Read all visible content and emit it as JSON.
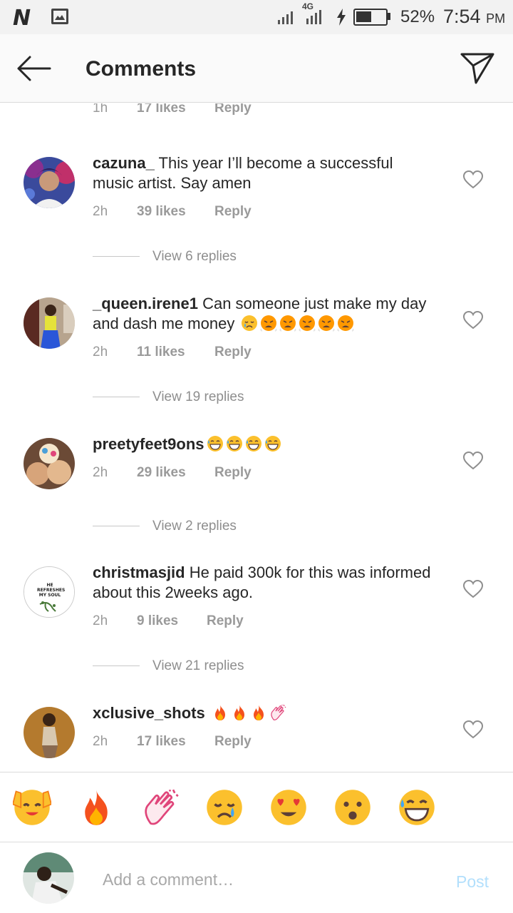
{
  "status_bar": {
    "network": "4G",
    "battery_percent": "52%",
    "battery_level": 0.52,
    "time": "7:54",
    "ampm": "PM"
  },
  "header": {
    "title": "Comments",
    "back_icon": "arrow-left-icon",
    "send_icon": "paper-plane-icon"
  },
  "top_meta": {
    "time": "1h",
    "likes": "17 likes",
    "reply": "Reply"
  },
  "comments": [
    {
      "username": "cazuna_",
      "text": "This year I’ll become a successful music artist. Say amen",
      "emojis": [],
      "time": "2h",
      "likes": "39 likes",
      "reply": "Reply",
      "view_replies": "View 6 replies"
    },
    {
      "username": "_queen.irene1",
      "text": "Can someone just make my day and dash me money",
      "emojis": [
        "crying-sad",
        "steam-angry",
        "steam-angry",
        "steam-angry",
        "steam-angry",
        "steam-angry"
      ],
      "time": "2h",
      "likes": "11 likes",
      "reply": "Reply",
      "view_replies": "View 19 replies"
    },
    {
      "username": "preetyfeet9ons",
      "text": "",
      "emojis": [
        "grin-sweat",
        "grin-sweat",
        "grin-sweat",
        "grin-sweat"
      ],
      "time": "2h",
      "likes": "29 likes",
      "reply": "Reply",
      "view_replies": "View 2 replies"
    },
    {
      "username": "christmasjid",
      "text": "He paid 300k for this was informed about this 2weeks ago.",
      "emojis": [],
      "time": "2h",
      "likes": "9 likes",
      "reply": "Reply",
      "view_replies": "View 21 replies"
    },
    {
      "username": "xclusive_shots",
      "text": "",
      "emojis": [
        "fire",
        "fire",
        "fire",
        "clapping-hands"
      ],
      "time": "2h",
      "likes": "17 likes",
      "reply": "Reply",
      "view_replies": ""
    }
  ],
  "avatar_text": {
    "christmasjid": "HE REFRESHES MY SOUL"
  },
  "emoji_bar": [
    "raised-hands",
    "fire",
    "clapping-hands",
    "crying-face",
    "heart-eyes",
    "surprised-face",
    "grin-sweat"
  ],
  "composer": {
    "placeholder": "Add a comment…",
    "post_label": "Post"
  },
  "colors": {
    "accent": "#b2dffc",
    "muted_text": "#8e8e8e",
    "divider": "#dbdbdb"
  }
}
